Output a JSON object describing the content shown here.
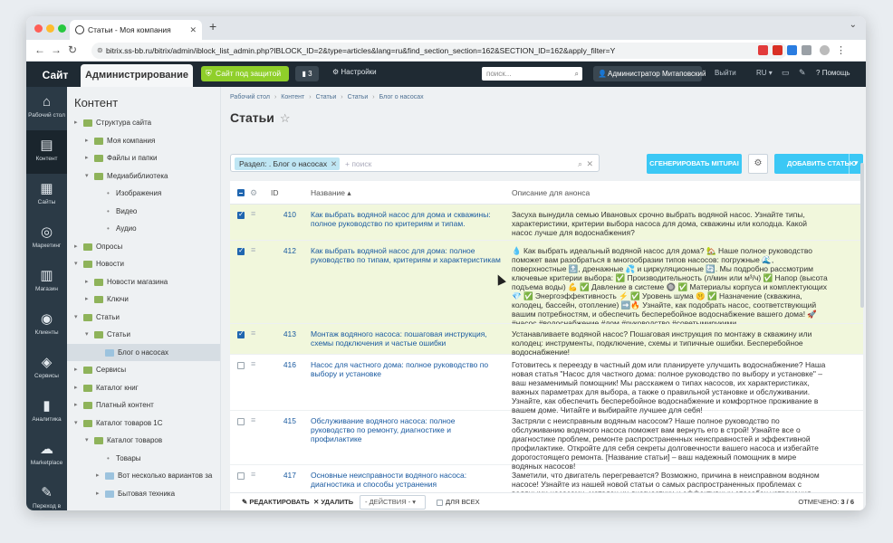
{
  "browser": {
    "tab_title": "Статьи - Моя компания",
    "url": "bitrix.ss-bb.ru/bitrix/admin/iblock_list_admin.php?IBLOCK_ID=2&type=articles&lang=ru&find_section_section=162&SECTION_ID=162&apply_filter=Y"
  },
  "admin_header": {
    "site_tab": "Сайт",
    "admin_tab": "Администрирование",
    "protect_label": "Сайт под защитой",
    "notif_count": "3",
    "settings_label": "Настройки",
    "search_placeholder": "поиск...",
    "user_label": "Администратор Митаповский",
    "exit_label": "Выйти",
    "lang_label": "RU",
    "help_label": "Помощь"
  },
  "rail": [
    {
      "label": "Рабочий стол",
      "icon": "home-icon"
    },
    {
      "label": "Контент",
      "icon": "document-icon"
    },
    {
      "label": "Сайты",
      "icon": "calendar-icon"
    },
    {
      "label": "Маркетинг",
      "icon": "target-icon"
    },
    {
      "label": "Магазин",
      "icon": "cart-icon"
    },
    {
      "label": "Клиенты",
      "icon": "user-icon"
    },
    {
      "label": "Сервисы",
      "icon": "layers-icon"
    },
    {
      "label": "Аналитика",
      "icon": "bar-chart-icon"
    },
    {
      "label": "Marketplace",
      "icon": "cloud-icon"
    },
    {
      "label": "Переход в",
      "icon": "edit-icon"
    }
  ],
  "tree": {
    "title": "Контент",
    "items": [
      {
        "label": "Структура сайта",
        "level": 0,
        "type": "arrow"
      },
      {
        "label": "Моя компания",
        "level": 1,
        "type": "arrow"
      },
      {
        "label": "Файлы и папки",
        "level": 1,
        "type": "arrow"
      },
      {
        "label": "Медиабиблиотека",
        "level": 1,
        "type": "open"
      },
      {
        "label": "Изображения",
        "level": 2,
        "type": "bullet"
      },
      {
        "label": "Видео",
        "level": 2,
        "type": "bullet"
      },
      {
        "label": "Аудио",
        "level": 2,
        "type": "bullet"
      },
      {
        "label": "Опросы",
        "level": 0,
        "type": "arrow"
      },
      {
        "label": "Новости",
        "level": 0,
        "type": "open"
      },
      {
        "label": "Новости магазина",
        "level": 1,
        "type": "arrow"
      },
      {
        "label": "Ключи",
        "level": 1,
        "type": "arrow"
      },
      {
        "label": "Статьи",
        "level": 0,
        "type": "open"
      },
      {
        "label": "Статьи",
        "level": 1,
        "type": "open"
      },
      {
        "label": "Блог о насосах",
        "level": 2,
        "type": "folder"
      },
      {
        "label": "Сервисы",
        "level": 0,
        "type": "arrow"
      },
      {
        "label": "Каталог книг",
        "level": 0,
        "type": "arrow"
      },
      {
        "label": "Платный контент",
        "level": 0,
        "type": "arrow"
      },
      {
        "label": "Каталог товаров 1С",
        "level": 0,
        "type": "open"
      },
      {
        "label": "Каталог товаров",
        "level": 1,
        "type": "open"
      },
      {
        "label": "Товары",
        "level": 2,
        "type": "bullet"
      },
      {
        "label": "Вот несколько вариантов за",
        "level": 2,
        "type": "folder-arrow"
      },
      {
        "label": "Бытовая техника",
        "level": 2,
        "type": "folder-arrow"
      }
    ]
  },
  "main": {
    "breadcrumbs": [
      "Рабочий стол",
      "Контент",
      "Статьи",
      "Статьи",
      "Блог о насосах"
    ],
    "title": "Статьи",
    "filter_chip": "Раздел: . Блог о насосах",
    "filter_placeholder": "+ поиск",
    "generate_label": "СГЕНЕРИРОВАТЬ MITUPAI",
    "add_label": "ДОБАВИТЬ СТАТЬЮ",
    "columns": {
      "id": "ID",
      "name": "Название",
      "desc": "Описание для анонса"
    },
    "rows": [
      {
        "id": "410",
        "checked": true,
        "name": "Как выбрать водяной насос для дома и скважины: полное руководство по критериям и типам.",
        "desc": "Засуха вынудила семью Ивановых срочно выбрать водяной насос. Узнайте типы, характеристики, критерии выбора насоса для дома, скважины или колодца. Какой насос лучше для водоснабжения?"
      },
      {
        "id": "412",
        "checked": true,
        "name": "Как выбрать водяной насос для дома: полное руководство по типам, критериям и характеристикам",
        "desc": "💧 Как выбрать идеальный водяной насос для дома? 🏡 Наше полное руководство поможет вам разобраться в многообразии типов насосов: погружные 🌊, поверхностные 🔝, дренажные 💦 и циркуляционные 🔄. Мы подробно рассмотрим ключевые критерии выбора: ✅ Производительность (л/мин или м³/ч) ✅ Напор (высота подъема воды) 💪 ✅ Давление в системе 🔘 ✅ Материалы корпуса и комплектующих 💎 ✅ Энергоэффективность ⚡ ✅ Уровень шума 🤫 ✅ Назначение (скважина, колодец, бассейн, отопление) ➡️🔥 Узнайте, как подобрать насос, соответствующий вашим потребностям, и обеспечить бесперебойное водоснабжение вашего дома! 🚀 #насос #водоснабжение #дом #руководство #советымирукими"
      },
      {
        "id": "413",
        "checked": true,
        "name": "Монтаж водяного насоса: пошаговая инструкция, схемы подключения и частые ошибки",
        "desc": "Устанавливаете водяной насос? Пошаговая инструкция по монтажу в скважину или колодец: инструменты, подключение, схемы и типичные ошибки. Бесперебойное водоснабжение!"
      },
      {
        "id": "416",
        "checked": false,
        "name": "Насос для частного дома: полное руководство по выбору и установке",
        "desc": "Готовитесь к переезду в частный дом или планируете улучшить водоснабжение? Наша новая статья \"Насос для частного дома: полное руководство по выбору и установке\" – ваш незаменимый помощник! Мы расскажем о типах насосов, их характеристиках, важных параметрах для выбора, а также о правильной установке и обслуживании. Узнайте, как обеспечить бесперебойное водоснабжение и комфортное проживание в вашем доме. Читайте и выбирайте лучшее для себя!"
      },
      {
        "id": "415",
        "checked": false,
        "name": "Обслуживание водяного насоса: полное руководство по ремонту, диагностике и профилактике",
        "desc": "Застряли с неисправным водяным насосом? Наше полное руководство по обслуживанию водяного насоса поможет вам вернуть его в строй! Узнайте все о диагностике проблем, ремонте распространенных неисправностей и эффективной профилактике. Откройте для себя секреты долговечности вашего насоса и избегайте дорогостоящего ремонта. [Название статьи] – ваш надежный помощник в мире водяных насосов!"
      },
      {
        "id": "417",
        "checked": false,
        "name": "Основные неисправности водяного насоса: диагностика и способы устранения",
        "desc": "Заметили, что двигатель перегревается? Возможно, причина в неисправном водяном насосе! Узнайте из нашей новой статьи о самых распространенных проблемах с водяными насосами, методах их диагностики и эффективных способах устранения. Спасите свой автомобиль от"
      }
    ],
    "footer": {
      "edit_label": "РЕДАКТИРОВАТЬ",
      "delete_label": "УДАЛИТЬ",
      "actions_label": "- ДЕЙСТВИЯ -",
      "all_label": "ДЛЯ ВСЕХ",
      "counter_label": "ОТМЕЧЕНО:",
      "counter_value": "3 / 6"
    }
  }
}
